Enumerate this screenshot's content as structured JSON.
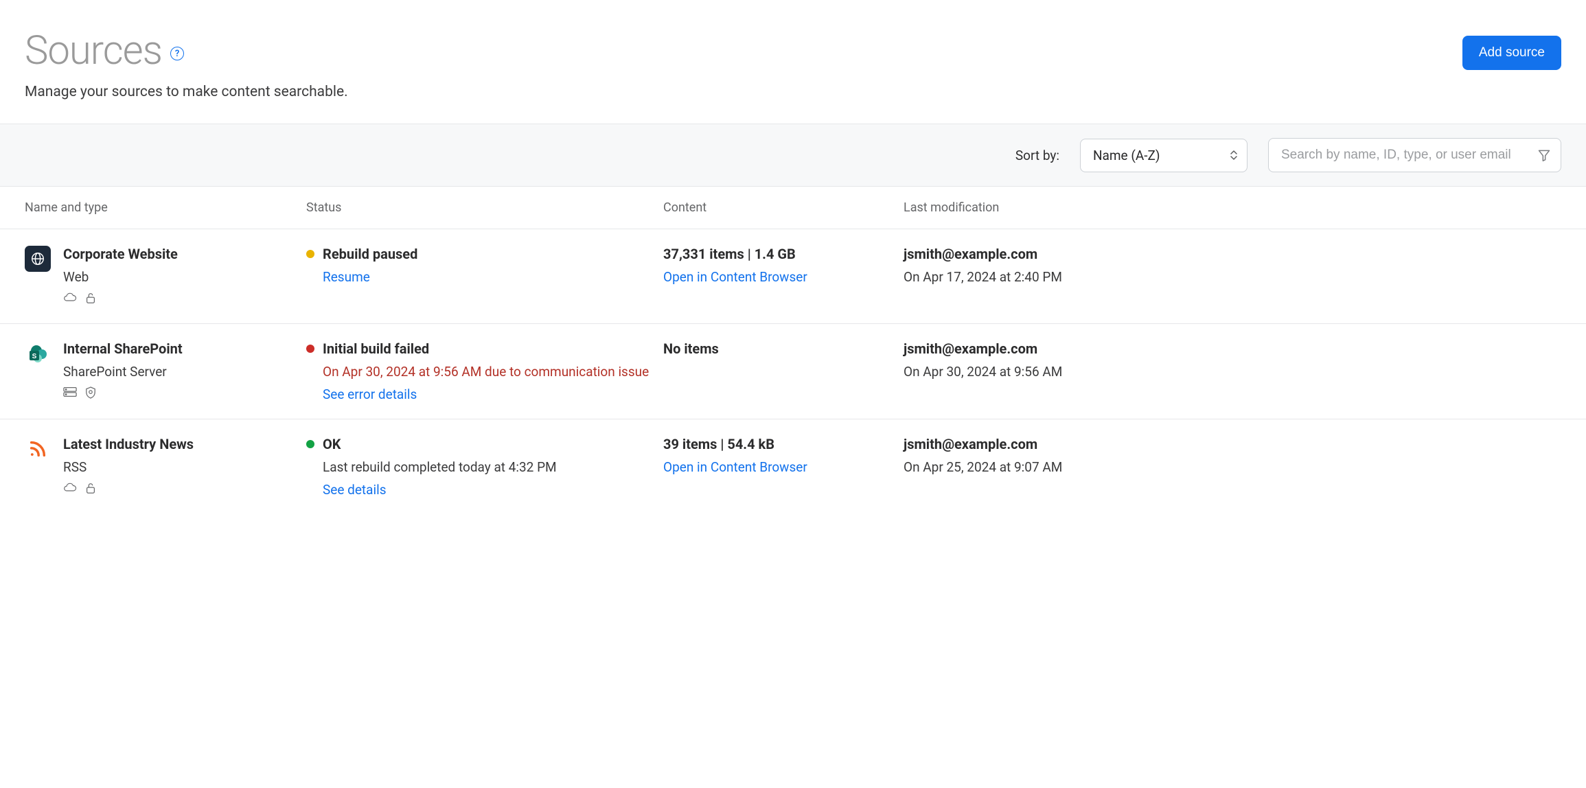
{
  "header": {
    "title": "Sources",
    "subtitle": "Manage your sources to make content searchable.",
    "add_button_label": "Add source",
    "help_icon_title": "Help"
  },
  "toolbar": {
    "sort_label": "Sort by:",
    "sort_value": "Name (A-Z)",
    "search_placeholder": "Search by name, ID, type, or user email"
  },
  "columns": {
    "name": "Name and type",
    "status": "Status",
    "content": "Content",
    "modified": "Last modification"
  },
  "status_colors": {
    "paused": "#e9b300",
    "error": "#cc2d28",
    "ok": "#12a244"
  },
  "actions": {
    "resume": "Resume",
    "open_content_browser": "Open in Content Browser",
    "see_error_details": "See error details",
    "see_details": "See details"
  },
  "rows": [
    {
      "name": "Corporate Website",
      "type": "Web",
      "icon": "globe",
      "status_label": "Rebuild paused",
      "status_kind": "paused",
      "status_detail": "",
      "status_action": "resume",
      "content_summary": "37,331 items | 1.4 GB",
      "content_action": "open_content_browser",
      "modified_by": "jsmith@example.com",
      "modified_on": "On Apr 17, 2024 at 2:40 PM",
      "badges": [
        "cloud",
        "unlocked"
      ]
    },
    {
      "name": "Internal SharePoint",
      "type": "SharePoint Server",
      "icon": "sharepoint",
      "status_label": "Initial build failed",
      "status_kind": "error",
      "status_detail": "On Apr 30, 2024 at 9:56 AM due to communication issue",
      "status_action": "see_error_details",
      "content_summary": "No items",
      "content_action": "",
      "modified_by": "jsmith@example.com",
      "modified_on": "On Apr 30, 2024 at 9:56 AM",
      "badges": [
        "server",
        "shield"
      ]
    },
    {
      "name": "Latest Industry News",
      "type": "RSS",
      "icon": "rss",
      "status_label": "OK",
      "status_kind": "ok",
      "status_detail": "Last rebuild completed today at 4:32 PM",
      "status_action": "see_details",
      "content_summary": "39 items | 54.4 kB",
      "content_action": "open_content_browser",
      "modified_by": "jsmith@example.com",
      "modified_on": "On Apr 25, 2024 at 9:07 AM",
      "badges": [
        "cloud",
        "unlocked"
      ]
    }
  ]
}
